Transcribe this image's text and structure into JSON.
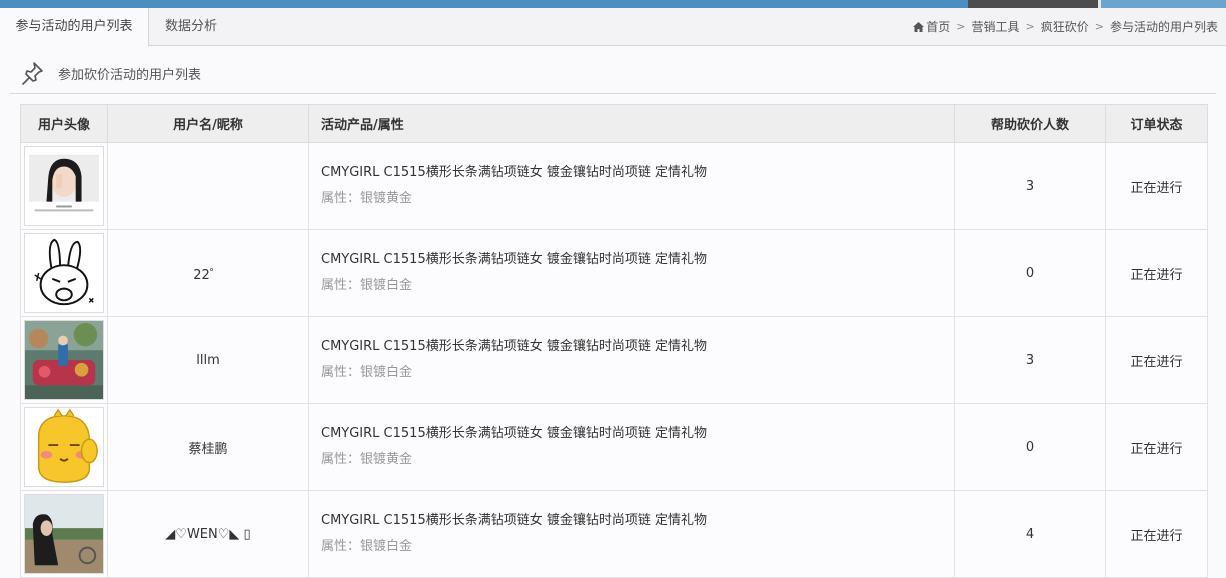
{
  "tabs": [
    {
      "label": "参与活动的用户列表",
      "active": true
    },
    {
      "label": "数据分析",
      "active": false
    }
  ],
  "breadcrumb": {
    "home": "首页",
    "items": [
      "营销工具",
      "疯狂砍价",
      "参与活动的用户列表"
    ],
    "separator": ">"
  },
  "section": {
    "title": "参加砍价活动的用户列表",
    "icon": "pushpin-icon"
  },
  "table": {
    "headers": {
      "avatar": "用户头像",
      "name": "用户名/昵称",
      "product": "活动产品/属性",
      "count": "帮助砍价人数",
      "status": "订单状态"
    },
    "rows": [
      {
        "avatar": "avatar-photo-girl",
        "name": "",
        "product": "CMYGIRL C1515横形长条满钻项链女 镀金镶钻时尚项链 定情礼物",
        "attr": "属性：银镀黄金",
        "count": "3",
        "status": "正在进行"
      },
      {
        "avatar": "avatar-rabbit-sticker",
        "name": "22゜",
        "product": "CMYGIRL C1515横形长条满钻项链女 镀金镶钻时尚项链 定情礼物",
        "attr": "属性：银镀白金",
        "count": "0",
        "status": "正在进行"
      },
      {
        "avatar": "avatar-colorful-scene",
        "name": "lllm",
        "product": "CMYGIRL C1515横形长条满钻项链女 镀金镶钻时尚项链 定情礼物",
        "attr": "属性：银镀白金",
        "count": "3",
        "status": "正在进行"
      },
      {
        "avatar": "avatar-yellow-cartoon",
        "name": "蔡桂鹏",
        "product": "CMYGIRL C1515横形长条满钻项链女 镀金镶钻时尚项链 定情礼物",
        "attr": "属性：银镀黄金",
        "count": "0",
        "status": "正在进行"
      },
      {
        "avatar": "avatar-photo-outdoor",
        "name": "◢♡WEN♡◣ ▯",
        "product": "CMYGIRL C1515横形长条满钻项链女 镀金镶钻时尚项链 定情礼物",
        "attr": "属性：银镀白金",
        "count": "4",
        "status": "正在进行"
      }
    ]
  },
  "colors": {
    "topbar": "#4a8fc0",
    "topbar_dark": "#4d4d4d",
    "topbar_light": "#6aa4cf",
    "header_bg": "#eeeeee",
    "attr_text": "#999999"
  }
}
